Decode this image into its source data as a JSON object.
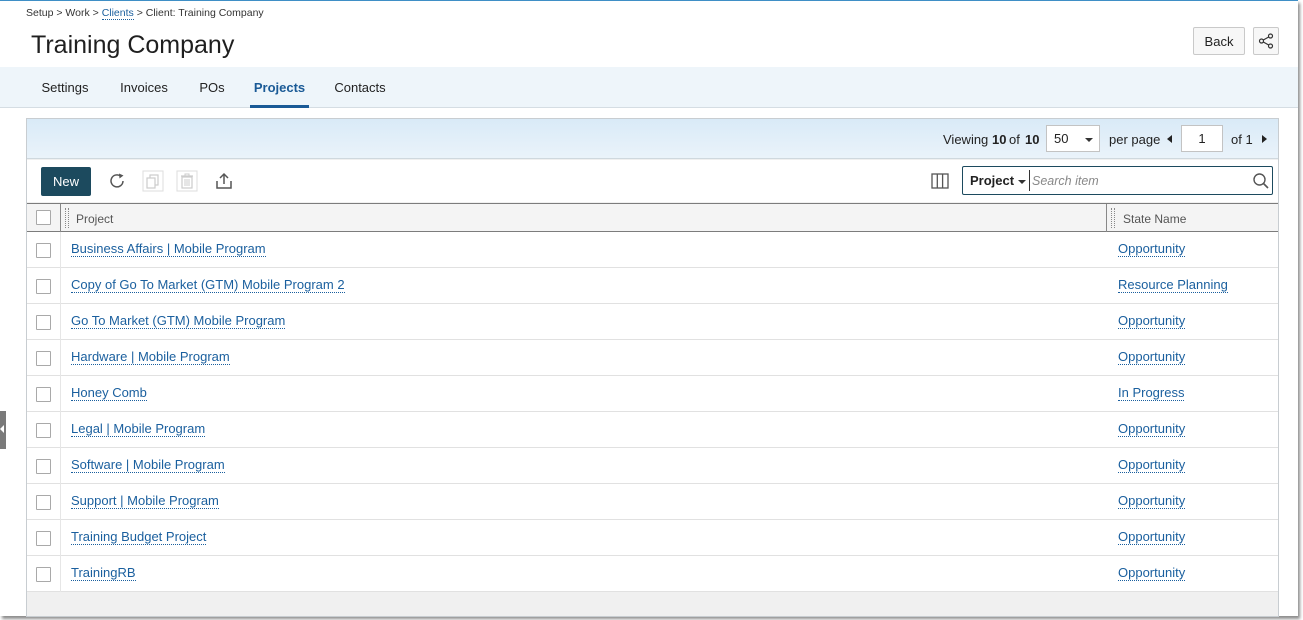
{
  "breadcrumb": {
    "part1": "Setup > Work > ",
    "link": "Clients",
    "part2": " > Client: Training Company"
  },
  "header": {
    "title": "Training Company",
    "back_label": "Back"
  },
  "tabs": [
    {
      "label": "Settings",
      "active": false
    },
    {
      "label": "Invoices",
      "active": false
    },
    {
      "label": "POs",
      "active": false
    },
    {
      "label": "Projects",
      "active": true
    },
    {
      "label": "Contacts",
      "active": false
    }
  ],
  "pager": {
    "viewing_label": "Viewing",
    "viewing_count": "10",
    "of_label": "of",
    "total": "10",
    "per_page_value": "50",
    "per_page_label": "per page",
    "page_number": "1",
    "of_pages_label": "of 1"
  },
  "toolbar": {
    "new_label": "New",
    "icons": [
      "refresh-icon",
      "copy-icon",
      "delete-icon",
      "export-icon",
      "columns-icon"
    ]
  },
  "search": {
    "scope": "Project",
    "placeholder": "Search item"
  },
  "table": {
    "columns": [
      "Project",
      "State Name"
    ],
    "rows": [
      {
        "project": "Business Affairs | Mobile Program",
        "state": "Opportunity"
      },
      {
        "project": "Copy of Go To Market (GTM) Mobile Program 2",
        "state": "Resource Planning"
      },
      {
        "project": "Go To Market (GTM) Mobile Program",
        "state": "Opportunity"
      },
      {
        "project": "Hardware | Mobile Program",
        "state": "Opportunity"
      },
      {
        "project": "Honey Comb",
        "state": "In Progress"
      },
      {
        "project": "Legal | Mobile Program",
        "state": "Opportunity"
      },
      {
        "project": "Software | Mobile Program",
        "state": "Opportunity"
      },
      {
        "project": "Support | Mobile Program",
        "state": "Opportunity"
      },
      {
        "project": "Training Budget Project",
        "state": "Opportunity"
      },
      {
        "project": "TrainingRB",
        "state": "Opportunity"
      }
    ]
  },
  "colors": {
    "accent": "#1a5a96",
    "new_button": "#1c4a5e",
    "link": "#1a5f9e",
    "tab_bar": "#eef5fa"
  }
}
